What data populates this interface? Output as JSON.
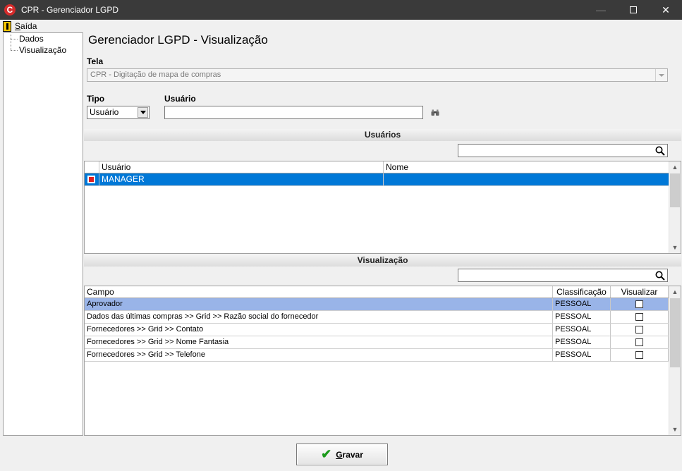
{
  "window": {
    "title": "CPR - Gerenciador LGPD",
    "icon": "app-logo-icon"
  },
  "menu": {
    "exit_prefix": "S",
    "exit_rest": "aída"
  },
  "tree": {
    "items": [
      "Dados",
      "Visualização"
    ]
  },
  "header": {
    "title": "Gerenciador LGPD - Visualização"
  },
  "form": {
    "tela_label": "Tela",
    "tela_value": "CPR - Digitação de mapa de compras",
    "tipo_label": "Tipo",
    "tipo_value": "Usuário",
    "usuario_label": "Usuário",
    "usuario_value": ""
  },
  "usuarios": {
    "section_title": "Usuários",
    "search_value": "",
    "columns": [
      "Usuário",
      "Nome"
    ],
    "rows": [
      {
        "checked": true,
        "usuario": "MANAGER",
        "nome": ""
      }
    ]
  },
  "visualizacao": {
    "section_title": "Visualização",
    "search_value": "",
    "columns": [
      "Campo",
      "Classificação",
      "Visualizar"
    ],
    "rows": [
      {
        "campo": "Aprovador",
        "classificacao": "PESSOAL",
        "visualizar": false
      },
      {
        "campo": "Dados das últimas compras >> Grid >> Razão social do fornecedor",
        "classificacao": "PESSOAL",
        "visualizar": false
      },
      {
        "campo": "Fornecedores >> Grid >> Contato",
        "classificacao": "PESSOAL",
        "visualizar": false
      },
      {
        "campo": "Fornecedores >> Grid >> Nome Fantasia",
        "classificacao": "PESSOAL",
        "visualizar": false
      },
      {
        "campo": "Fornecedores >> Grid >> Telefone",
        "classificacao": "PESSOAL",
        "visualizar": false
      }
    ]
  },
  "footer": {
    "save_prefix": "G",
    "save_rest": "ravar"
  },
  "colors": {
    "titlebar": "#3a3a3a",
    "selection": "#0078d7",
    "selection_light": "#99b4e8",
    "save_check": "#1a9a1a"
  }
}
